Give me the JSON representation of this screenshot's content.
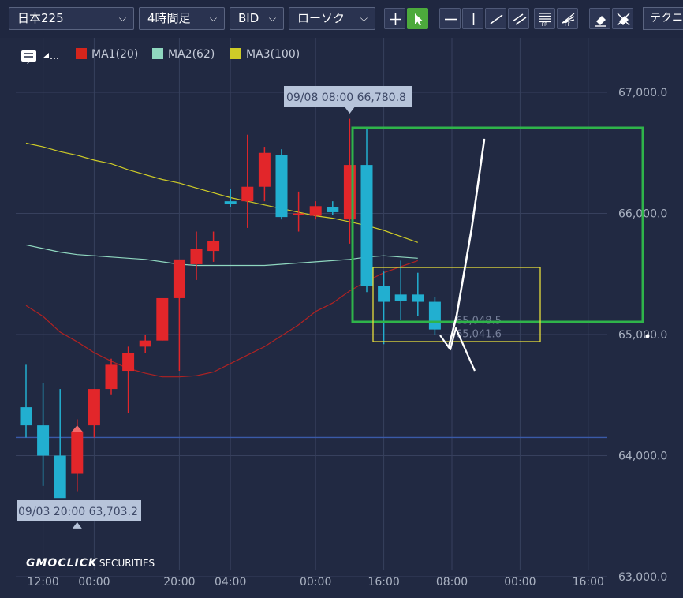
{
  "toolbar": {
    "symbol": "日本225",
    "timeframe": "4時間足",
    "price_type": "BID",
    "chart_style": "ローソク",
    "technical_label": "テクニ",
    "tools": [
      {
        "name": "crosshair-tool",
        "icon": "plus-icon"
      },
      {
        "name": "pointer-tool",
        "icon": "cursor-arrow-icon",
        "active": true
      },
      {
        "name": "horizontal-line-tool",
        "icon": "horizontal-line-icon"
      },
      {
        "name": "vertical-line-tool",
        "icon": "vertical-line-icon"
      },
      {
        "name": "trend-line-tool",
        "icon": "diagonal-line-icon"
      },
      {
        "name": "parallel-channel-tool",
        "icon": "parallel-lines-icon"
      },
      {
        "name": "fibonacci-retracement-tool",
        "icon": "fibonacci-retracement-icon",
        "sub": "FR"
      },
      {
        "name": "fibonacci-fan-tool",
        "icon": "fibonacci-fan-icon",
        "sub": "FF"
      },
      {
        "name": "eraser-tool",
        "icon": "eraser-icon"
      },
      {
        "name": "erase-all-tool",
        "icon": "eraser-all-icon"
      }
    ]
  },
  "legend": {
    "items": [
      {
        "label": "MA1(20)",
        "color": "#d4251c"
      },
      {
        "label": "MA2(62)",
        "color": "#8fd7bf"
      },
      {
        "label": "MA3(100)",
        "color": "#cfcc27"
      }
    ]
  },
  "logo": {
    "main": "GMOCLICK",
    "sub": "SECURITIES"
  },
  "chart_data": {
    "type": "candlestick",
    "y_ticks": [
      "67,000.0",
      "66,000.0",
      "65,000.0",
      "64,000.0",
      "63,000.0"
    ],
    "y_tick_values": [
      67000,
      66000,
      65000,
      64000,
      63000
    ],
    "x_ticks": [
      "12:00",
      "00:00",
      "20:00",
      "04:00",
      "00:00",
      "16:00",
      "08:00",
      "00:00",
      "16:00"
    ],
    "ylim": [
      62900,
      67700
    ],
    "grid": true,
    "colors": {
      "up": "#e2262a",
      "down": "#22afd0",
      "grid": "#37405d",
      "axis_text": "#aab2c2",
      "reference_line": "#3a5aa8",
      "annotation_box_green": "#2fb44a",
      "annotation_box_yellow": "#e6dd3b",
      "annotation_line": "#ffffff"
    },
    "candles": [
      {
        "o": 64400,
        "h": 64750,
        "l": 64150,
        "c": 64250
      },
      {
        "o": 64250,
        "h": 64600,
        "l": 63750,
        "c": 64000
      },
      {
        "o": 64000,
        "h": 64550,
        "l": 63800,
        "c": 63650
      },
      {
        "o": 63850,
        "h": 64300,
        "l": 63700,
        "c": 64200
      },
      {
        "o": 64250,
        "h": 64550,
        "l": 64150,
        "c": 64550
      },
      {
        "o": 64550,
        "h": 64800,
        "l": 64500,
        "c": 64750
      },
      {
        "o": 64700,
        "h": 64900,
        "l": 64350,
        "c": 64850
      },
      {
        "o": 64900,
        "h": 65000,
        "l": 64850,
        "c": 64950
      },
      {
        "o": 64950,
        "h": 65200,
        "l": 64950,
        "c": 65300
      },
      {
        "o": 65300,
        "h": 65600,
        "l": 64700,
        "c": 65620
      },
      {
        "o": 65580,
        "h": 65850,
        "l": 65450,
        "c": 65710
      },
      {
        "o": 65690,
        "h": 65850,
        "l": 65600,
        "c": 65770
      },
      {
        "o": 66100,
        "h": 66200,
        "l": 66050,
        "c": 66080
      },
      {
        "o": 66100,
        "h": 66650,
        "l": 65880,
        "c": 66220
      },
      {
        "o": 66220,
        "h": 66550,
        "l": 66100,
        "c": 66500
      },
      {
        "o": 66480,
        "h": 66530,
        "l": 65950,
        "c": 65970
      },
      {
        "o": 65990,
        "h": 66180,
        "l": 65850,
        "c": 66000
      },
      {
        "o": 65980,
        "h": 66100,
        "l": 65950,
        "c": 66060
      },
      {
        "o": 66050,
        "h": 66100,
        "l": 65990,
        "c": 66010
      },
      {
        "o": 65950,
        "h": 66780.8,
        "l": 65750,
        "c": 66400
      },
      {
        "o": 66400,
        "h": 66700,
        "l": 65350,
        "c": 65400
      },
      {
        "o": 65400,
        "h": 65520,
        "l": 64920,
        "c": 65270
      },
      {
        "o": 65330,
        "h": 65610,
        "l": 65120,
        "c": 65280
      },
      {
        "o": 65330,
        "h": 65510,
        "l": 65150,
        "c": 65270
      },
      {
        "o": 65270,
        "h": 65310,
        "l": 65000,
        "c": 65041.6
      }
    ],
    "ma1": [
      65240,
      65150,
      65020,
      64940,
      64850,
      64780,
      64720,
      64680,
      64650,
      64650,
      64660,
      64690,
      64760,
      64830,
      64900,
      64990,
      65080,
      65190,
      65260,
      65360,
      65440,
      65510,
      65560,
      65610
    ],
    "ma2": [
      65740,
      65710,
      65680,
      65660,
      65650,
      65640,
      65630,
      65620,
      65600,
      65580,
      65570,
      65570,
      65570,
      65570,
      65570,
      65580,
      65590,
      65600,
      65610,
      65620,
      65640,
      65650,
      65640,
      65630
    ],
    "ma3": [
      66580,
      66550,
      66510,
      66480,
      66440,
      66410,
      66360,
      66320,
      66280,
      66250,
      66210,
      66170,
      66130,
      66100,
      66070,
      66040,
      66010,
      65980,
      65960,
      65930,
      65900,
      65860,
      65810,
      65760
    ],
    "reference_line_value": 64150,
    "high_label": "09/08 08:00 66,780.8",
    "low_label": "09/03 20:00 63,703.2",
    "price_labels": [
      "65,048.5",
      "65,041.6"
    ],
    "price_label_values": [
      65048.5,
      65041.6
    ],
    "current_price_value": 65000
  }
}
